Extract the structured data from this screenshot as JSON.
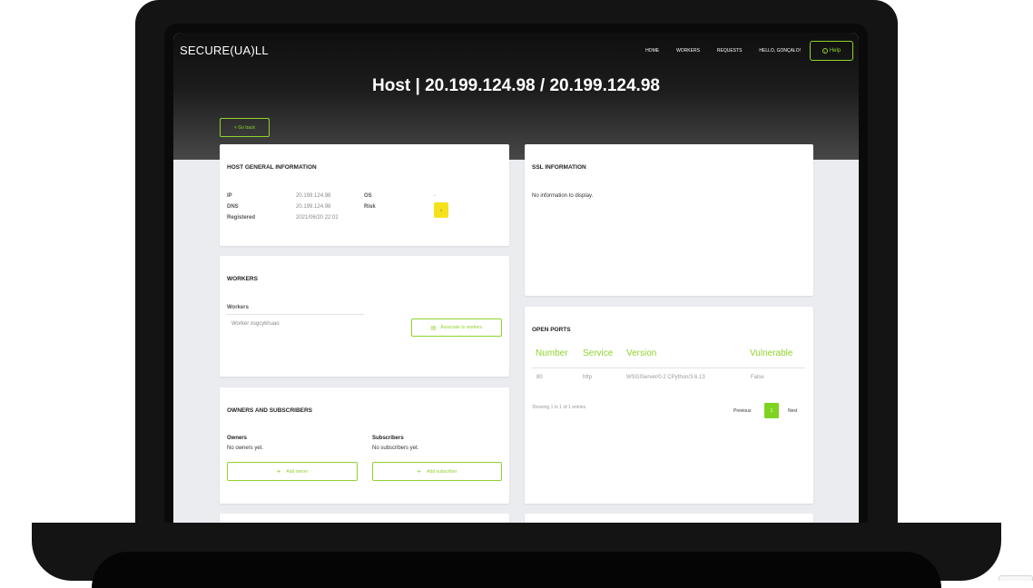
{
  "header": {
    "brand": "SECURE(UA)LL",
    "nav": [
      "HOME",
      "WORKERS",
      "REQUESTS",
      "HELLO, GONÇALO!"
    ],
    "help_label": "Help",
    "title": "Host | 20.199.124.98 / 20.199.124.98",
    "back_label": "< Go back"
  },
  "host_info": {
    "title": "HOST GENERAL INFORMATION",
    "ip_label": "IP",
    "ip_value": "20.199.124.98",
    "dns_label": "DNS",
    "dns_value": "20.199.124.98",
    "registered_label": "Registered",
    "registered_value": "2021/06/20 22:02",
    "os_label": "OS",
    "os_value": "-",
    "risk_label": "Risk",
    "risk_value": "1",
    "risk_color": "#f5e21b"
  },
  "ssl": {
    "title": "SSL INFORMATION",
    "empty_text": "No information to display."
  },
  "workers": {
    "title": "WORKERS",
    "list_header": "Workers",
    "items": [
      "Worker xsgcykhuao"
    ],
    "associate_label": "Associate to workers"
  },
  "open_ports": {
    "title": "OPEN PORTS",
    "columns": [
      "Number",
      "Service",
      "Version",
      "Vulnerable"
    ],
    "rows": [
      {
        "number": "80",
        "service": "http",
        "version": "WSGIServer/0.2 CPython/3.6.13",
        "vulnerable": "False"
      }
    ],
    "info": "Showing 1 to 1 of 1 entries",
    "previous_label": "Previous",
    "current_page": "1",
    "next_label": "Next"
  },
  "owners": {
    "title": "OWNERS AND SUBSCRIBERS",
    "owners_label": "Owners",
    "owners_empty": "No owners yet.",
    "subscribers_label": "Subscribers",
    "subscribers_empty": "No subscribers yet.",
    "add_owner_label": "Add owner",
    "add_subscriber_label": "Add subscriber"
  },
  "accent_color": "#8fd42b"
}
